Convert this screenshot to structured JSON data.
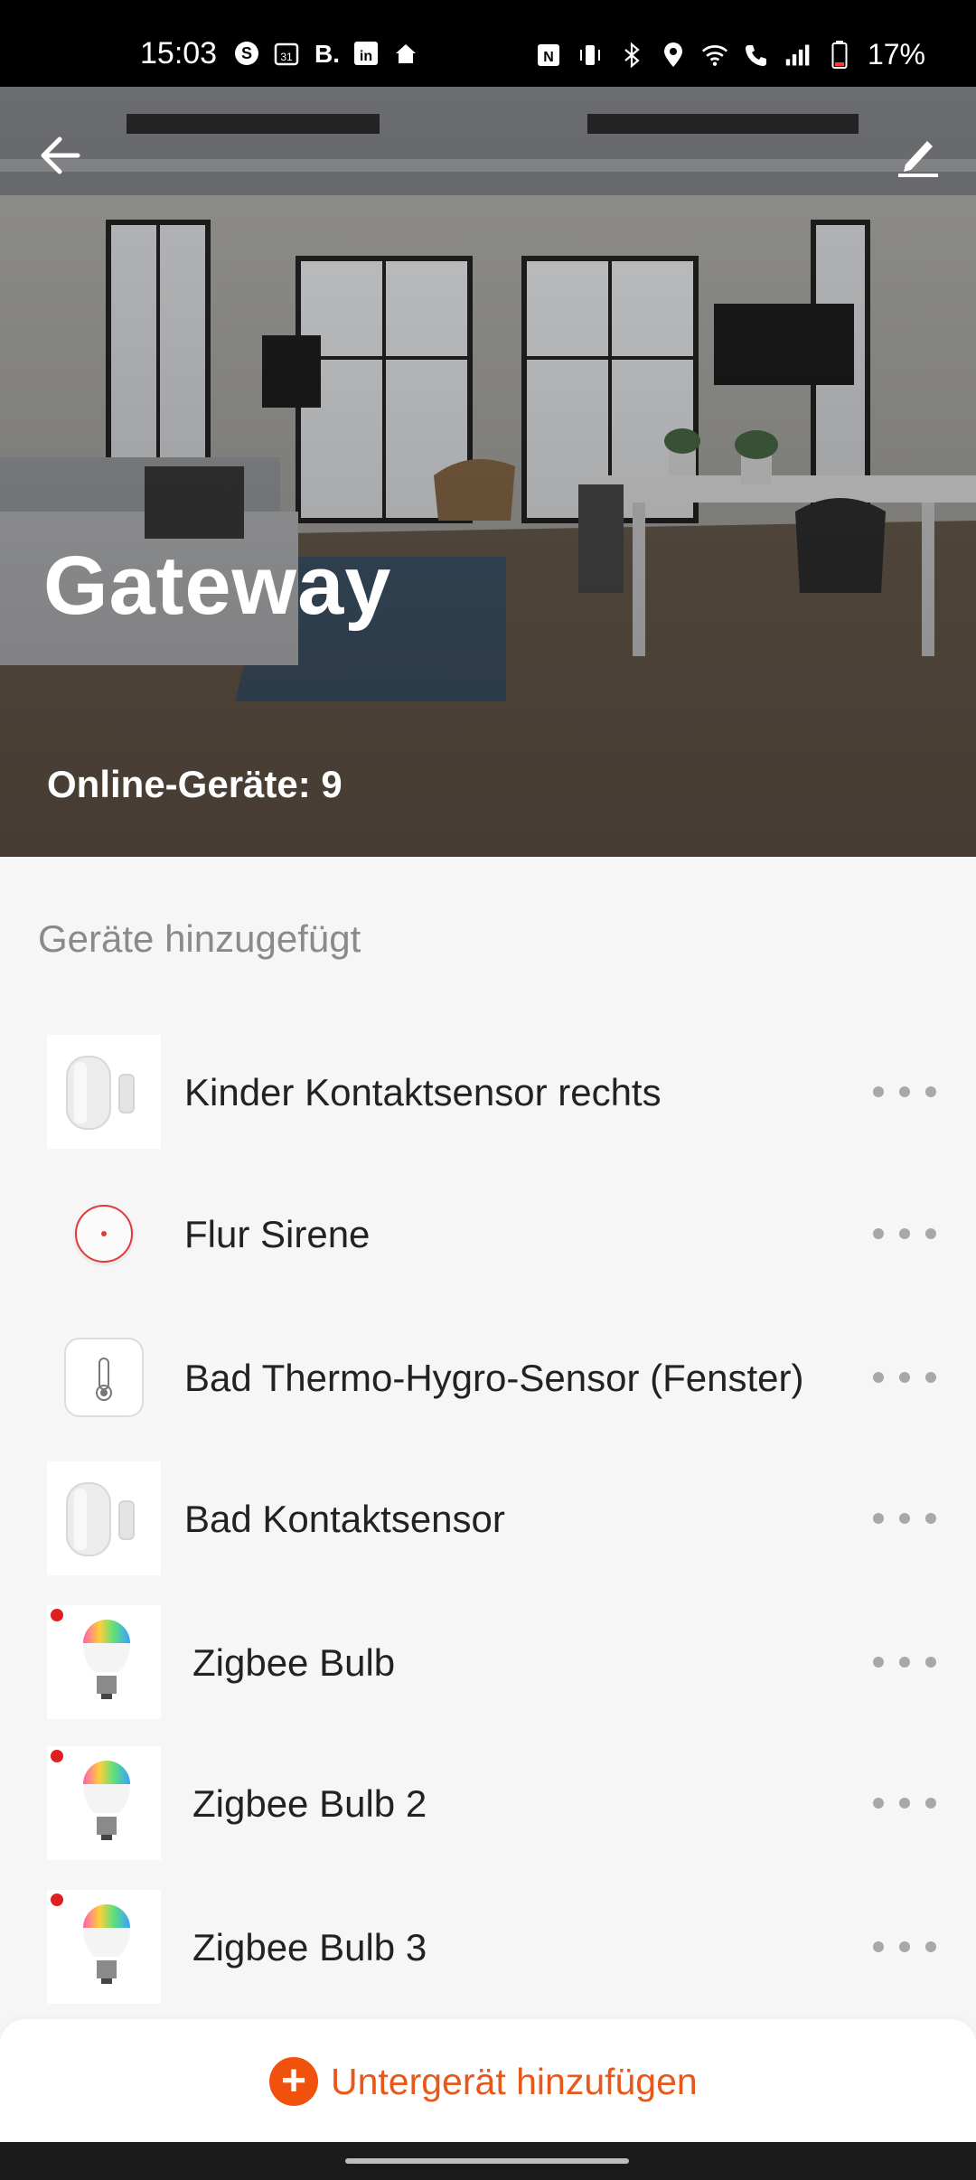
{
  "status_bar": {
    "time": "15:03",
    "left_icons": [
      "skype-icon",
      "calendar-icon",
      "booking-icon",
      "linkedin-icon",
      "home-icon"
    ],
    "right_icons": [
      "nfc-icon",
      "vibrate-icon",
      "bluetooth-icon",
      "location-icon",
      "wifi-icon",
      "wifi-call-icon",
      "signal-icon",
      "battery-icon"
    ],
    "battery": "17%"
  },
  "header": {
    "title": "Gateway",
    "online_label": "Online-Geräte: 9"
  },
  "section_title": "Geräte hinzugefügt",
  "devices": [
    {
      "name": "Kinder Kontaktsensor rechts",
      "icon": "contact-sensor-icon"
    },
    {
      "name": "Flur Sirene",
      "icon": "siren-icon"
    },
    {
      "name": "Bad Thermo-Hygro-Sensor (Fenster)",
      "icon": "thermo-hygro-sensor-icon"
    },
    {
      "name": "Bad Kontaktsensor",
      "icon": "contact-sensor-icon"
    },
    {
      "name": "Zigbee Bulb",
      "icon": "zigbee-bulb-icon"
    },
    {
      "name": "Zigbee Bulb 2",
      "icon": "zigbee-bulb-icon"
    },
    {
      "name": "Zigbee Bulb 3",
      "icon": "zigbee-bulb-icon"
    }
  ],
  "add_button": {
    "label": "Untergerät hinzufügen"
  },
  "colors": {
    "accent": "#f0520e",
    "text": "#222222",
    "muted": "#8a8a8a"
  }
}
